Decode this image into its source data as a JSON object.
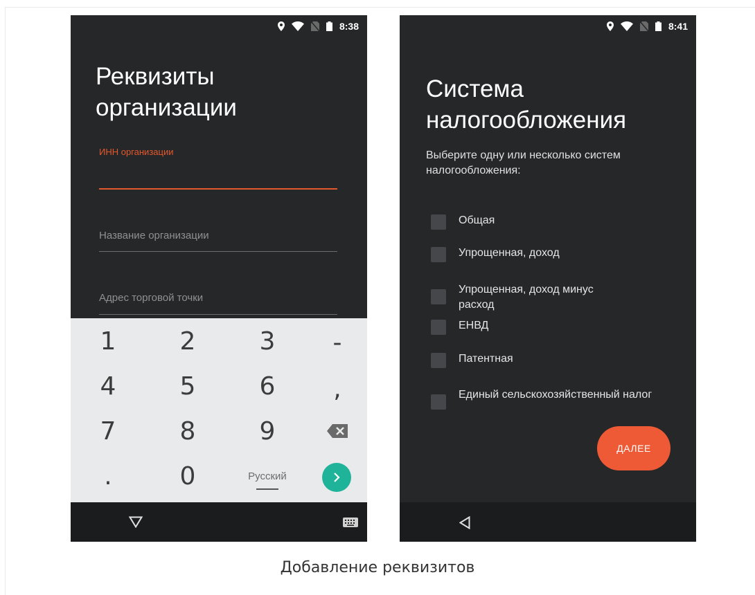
{
  "left_screen": {
    "status_time": "8:38",
    "title_line1": "Реквизиты",
    "title_line2": "организации",
    "fields": [
      {
        "label": "ИНН организации",
        "value": ""
      },
      {
        "label": "Название организации",
        "value": ""
      },
      {
        "label": "Адрес торговой точки",
        "value": ""
      }
    ],
    "keyboard": {
      "keys": [
        "1",
        "2",
        "3",
        "-",
        "4",
        "5",
        "6",
        ",",
        "7",
        "8",
        "9",
        ".",
        "0"
      ],
      "language_label": "Русский",
      "backspace_icon": "backspace-icon",
      "enter_icon": "chevron-right-icon"
    },
    "nav_icons": [
      "triangle-down-icon",
      "keyboard-icon"
    ]
  },
  "right_screen": {
    "status_time": "8:41",
    "title_line1": "Система",
    "title_line2": "налогообложения",
    "subtitle": "Выберите одну или несколько систем налогообложения:",
    "options": [
      {
        "label": "Общая",
        "checked": false
      },
      {
        "label": "Упрощенная, доход",
        "checked": false
      },
      {
        "label": "Упрощенная, доход минус расход",
        "checked": false
      },
      {
        "label": "ЕНВД",
        "checked": false
      },
      {
        "label": "Патентная",
        "checked": false
      },
      {
        "label": "Единый сельскохозяйственный налог",
        "checked": false
      }
    ],
    "next_button": "ДАЛЕЕ",
    "nav_icons": [
      "back-icon"
    ]
  },
  "caption": "Добавление реквизитов",
  "colors": {
    "accent": "#ee5a36",
    "screen_bg": "#262728",
    "keyboard_bg": "#e8eaeb",
    "enter_key": "#1fb39a"
  }
}
